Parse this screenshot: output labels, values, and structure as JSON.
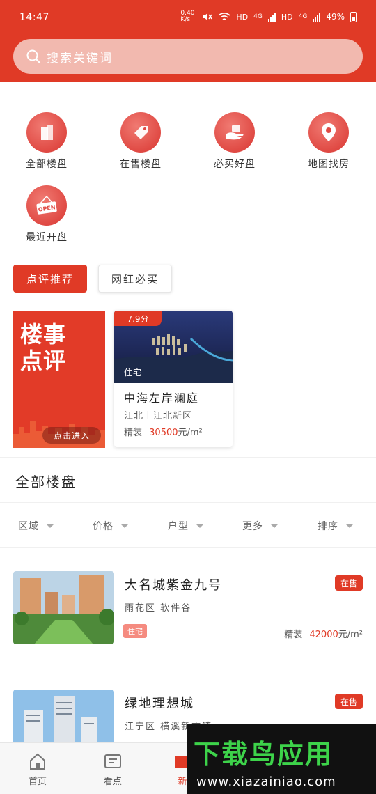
{
  "status_bar": {
    "time": "14:47",
    "net_speed": "0.40 K/s",
    "hd1": "HD",
    "g1": "4G",
    "hd2": "HD",
    "g2": "4G",
    "battery": "49%"
  },
  "search": {
    "placeholder": "搜索关键词"
  },
  "categories": [
    {
      "label": "全部楼盘",
      "icon": "buildings-icon"
    },
    {
      "label": "在售楼盘",
      "icon": "price-tag-icon"
    },
    {
      "label": "必买好盘",
      "icon": "hand-icon"
    },
    {
      "label": "地图找房",
      "icon": "map-pin-icon"
    },
    {
      "label": "最近开盘",
      "icon": "open-sign-icon",
      "sign_text": "OPEN"
    }
  ],
  "tabs": {
    "active": "点评推荐",
    "inactive": "网红必买"
  },
  "promo": {
    "title_line1": "楼事",
    "title_line2": "点评",
    "enter": "点击进入"
  },
  "featured": {
    "score": "7.9分",
    "type": "住宅",
    "name": "中海左岸澜庭",
    "location": "江北丨江北新区",
    "decor": "精装",
    "price_num": "30500",
    "price_unit": "元/m²"
  },
  "section_title": "全部楼盘",
  "filters": [
    "区域",
    "价格",
    "户型",
    "更多",
    "排序"
  ],
  "listings": [
    {
      "name": "大名城紫金九号",
      "status": "在售",
      "location": "雨花区  软件谷",
      "tag": "住宅",
      "decor": "精装",
      "price_num": "42000",
      "price_unit": "元/m²"
    },
    {
      "name": "绿地理想城",
      "status": "在售",
      "location": "江宁区  横溪新市镇"
    }
  ],
  "bottom_nav": [
    {
      "label": "首页",
      "icon": "home-icon"
    },
    {
      "label": "看点",
      "icon": "news-icon"
    },
    {
      "label": "新",
      "icon": "new-house-icon"
    }
  ],
  "watermark": {
    "brand": "下载鸟应用",
    "url": "www.xiazainiao.com"
  },
  "colors": {
    "brand_red": "#e03a26",
    "tag_pink": "#f58b80",
    "watermark_green": "#3dd34a"
  }
}
